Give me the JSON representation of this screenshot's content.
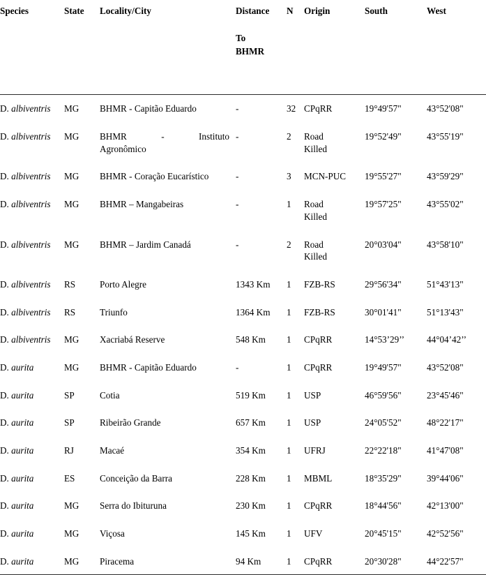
{
  "table": {
    "columns": [
      {
        "key": "species",
        "label": "Species"
      },
      {
        "key": "state",
        "label": "State"
      },
      {
        "key": "locality",
        "label": "Locality/City"
      },
      {
        "key": "distance",
        "label": "Distance",
        "sub_lines": [
          "To",
          "BHMR"
        ]
      },
      {
        "key": "n",
        "label": "N"
      },
      {
        "key": "origin",
        "label": "Origin"
      },
      {
        "key": "south",
        "label": "South"
      },
      {
        "key": "west",
        "label": "West"
      }
    ],
    "rows": [
      {
        "species_abbr": "D.",
        "species_epithet": "albiventris",
        "state": "MG",
        "locality": "BHMR - Capitão Eduardo",
        "distance": "-",
        "n": "32",
        "origin": "CPqRR",
        "south": "19°49'57\"",
        "west": "43°52'08\""
      },
      {
        "species_abbr": "D.",
        "species_epithet": "albiventris",
        "state": "MG",
        "locality": "BHMR - Instituto Agronômico",
        "locality_justified_line1": "BHMR - Instituto",
        "locality_justified_line2": "Agronômico",
        "distance": "-",
        "n": "2",
        "origin": "Road Killed",
        "origin_lines": [
          "Road",
          "Killed"
        ],
        "south": "19°52'49\"",
        "west": "43°55'19\""
      },
      {
        "species_abbr": "D.",
        "species_epithet": "albiventris",
        "state": "MG",
        "locality": "BHMR - Coração Eucarístico",
        "distance": "-",
        "n": "3",
        "origin": "MCN-PUC",
        "south": "19°55'27\"",
        "west": "43°59'29\""
      },
      {
        "species_abbr": "D.",
        "species_epithet": "albiventris",
        "state": "MG",
        "locality": "BHMR – Mangabeiras",
        "distance": "-",
        "n": "1",
        "origin": "Road Killed",
        "origin_lines": [
          "Road",
          "Killed"
        ],
        "south": "19°57'25\"",
        "west": "43°55'02\""
      },
      {
        "species_abbr": "D.",
        "species_epithet": "albiventris",
        "state": "MG",
        "locality": "BHMR – Jardim Canadá",
        "distance": "-",
        "n": "2",
        "origin": "Road Killed",
        "origin_lines": [
          "Road",
          "Killed"
        ],
        "south": "20°03'04\"",
        "west": "43°58'10\""
      },
      {
        "species_abbr": "D.",
        "species_epithet": "albiventris",
        "state": "RS",
        "locality": "Porto Alegre",
        "distance": "1343 Km",
        "n": "1",
        "origin": "FZB-RS",
        "south": "29°56'34\"",
        "west": "51°43'13\""
      },
      {
        "species_abbr": "D.",
        "species_epithet": "albiventris",
        "state": "RS",
        "locality": "Triunfo",
        "distance": "1364 Km",
        "n": "1",
        "origin": "FZB-RS",
        "south": "30°01'41\"",
        "west": "51°13'43\""
      },
      {
        "species_abbr": "D.",
        "species_epithet": "albiventris",
        "state": "MG",
        "locality": "Xacriabá Reserve",
        "distance": "548 Km",
        "n": "1",
        "origin": "CPqRR",
        "south": "14°53’29’’",
        "west": "44°04’42’’"
      },
      {
        "species_abbr": "D.",
        "species_epithet": "aurita",
        "state": "MG",
        "locality": "BHMR - Capitão Eduardo",
        "distance": "-",
        "n": "1",
        "origin": "CPqRR",
        "south": "19°49'57\"",
        "west": "43°52'08\""
      },
      {
        "species_abbr": "D.",
        "species_epithet": "aurita",
        "state": "SP",
        "locality": "Cotia",
        "distance": "519 Km",
        "n": "1",
        "origin": "USP",
        "south": "46°59'56\"",
        "west": "23°45'46\""
      },
      {
        "species_abbr": "D.",
        "species_epithet": "aurita",
        "state": "SP",
        "locality": "Ribeirão Grande",
        "distance": "657 Km",
        "n": "1",
        "origin": "USP",
        "south": "24°05'52\"",
        "west": "48°22'17\""
      },
      {
        "species_abbr": "D.",
        "species_epithet": "aurita",
        "state": "RJ",
        "locality": "Macaé",
        "distance": "354 Km",
        "n": "1",
        "origin": "UFRJ",
        "south": "22°22'18\"",
        "west": "41°47'08\""
      },
      {
        "species_abbr": "D.",
        "species_epithet": "aurita",
        "state": "ES",
        "locality": "Conceição da Barra",
        "distance": "228 Km",
        "n": "1",
        "origin": "MBML",
        "south": "18°35'29\"",
        "west": "39°44'06\""
      },
      {
        "species_abbr": "D.",
        "species_epithet": "aurita",
        "state": "MG",
        "locality": "Serra do Ibituruna",
        "distance": "230 Km",
        "n": "1",
        "origin": "CPqRR",
        "south": "18°44'56\"",
        "west": "42°13'00\""
      },
      {
        "species_abbr": "D.",
        "species_epithet": "aurita",
        "state": "MG",
        "locality": "Viçosa",
        "distance": "145 Km",
        "n": "1",
        "origin": "UFV",
        "south": "20°45'15\"",
        "west": "42°52'56\""
      },
      {
        "species_abbr": "D.",
        "species_epithet": "aurita",
        "state": "MG",
        "locality": "Piracema",
        "distance": "94 Km",
        "n": "1",
        "origin": "CPqRR",
        "south": "20°30'28\"",
        "west": "44°22'57\""
      }
    ]
  }
}
